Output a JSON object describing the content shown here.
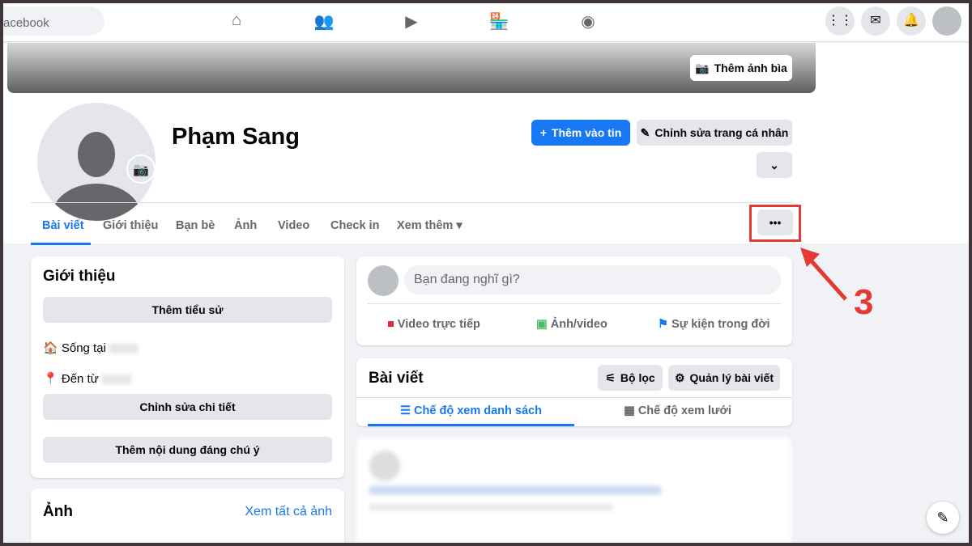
{
  "topbar": {
    "search_text": "acebook"
  },
  "profile": {
    "name": "Phạm Sang",
    "add_cover": "Thêm ảnh bìa",
    "add_story": "Thêm vào tin",
    "edit_profile": "Chỉnh sửa trang cá nhân"
  },
  "tabs": [
    "Bài viết",
    "Giới thiệu",
    "Bạn bè",
    "Ảnh",
    "Video",
    "Check in",
    "Xem thêm"
  ],
  "intro": {
    "title": "Giới thiệu",
    "add_bio": "Thêm tiểu sử",
    "lives_in": "Sống tại",
    "from": "Đến từ",
    "edit_details": "Chỉnh sửa chi tiết",
    "add_featured": "Thêm nội dung đáng chú ý"
  },
  "photos": {
    "title": "Ảnh",
    "see_all": "Xem tất cả ảnh"
  },
  "composer": {
    "placeholder": "Bạn đang nghĩ gì?",
    "live": "Video trực tiếp",
    "photo": "Ảnh/video",
    "event": "Sự kiện trong đời"
  },
  "posts": {
    "title": "Bài viết",
    "filter": "Bộ lọc",
    "manage": "Quản lý bài viết",
    "list_view": "Chế độ xem danh sách",
    "grid_view": "Chế độ xem lưới"
  },
  "annotation": {
    "step": "3",
    "color": "#e53935"
  },
  "colors": {
    "accent": "#1877f2"
  }
}
